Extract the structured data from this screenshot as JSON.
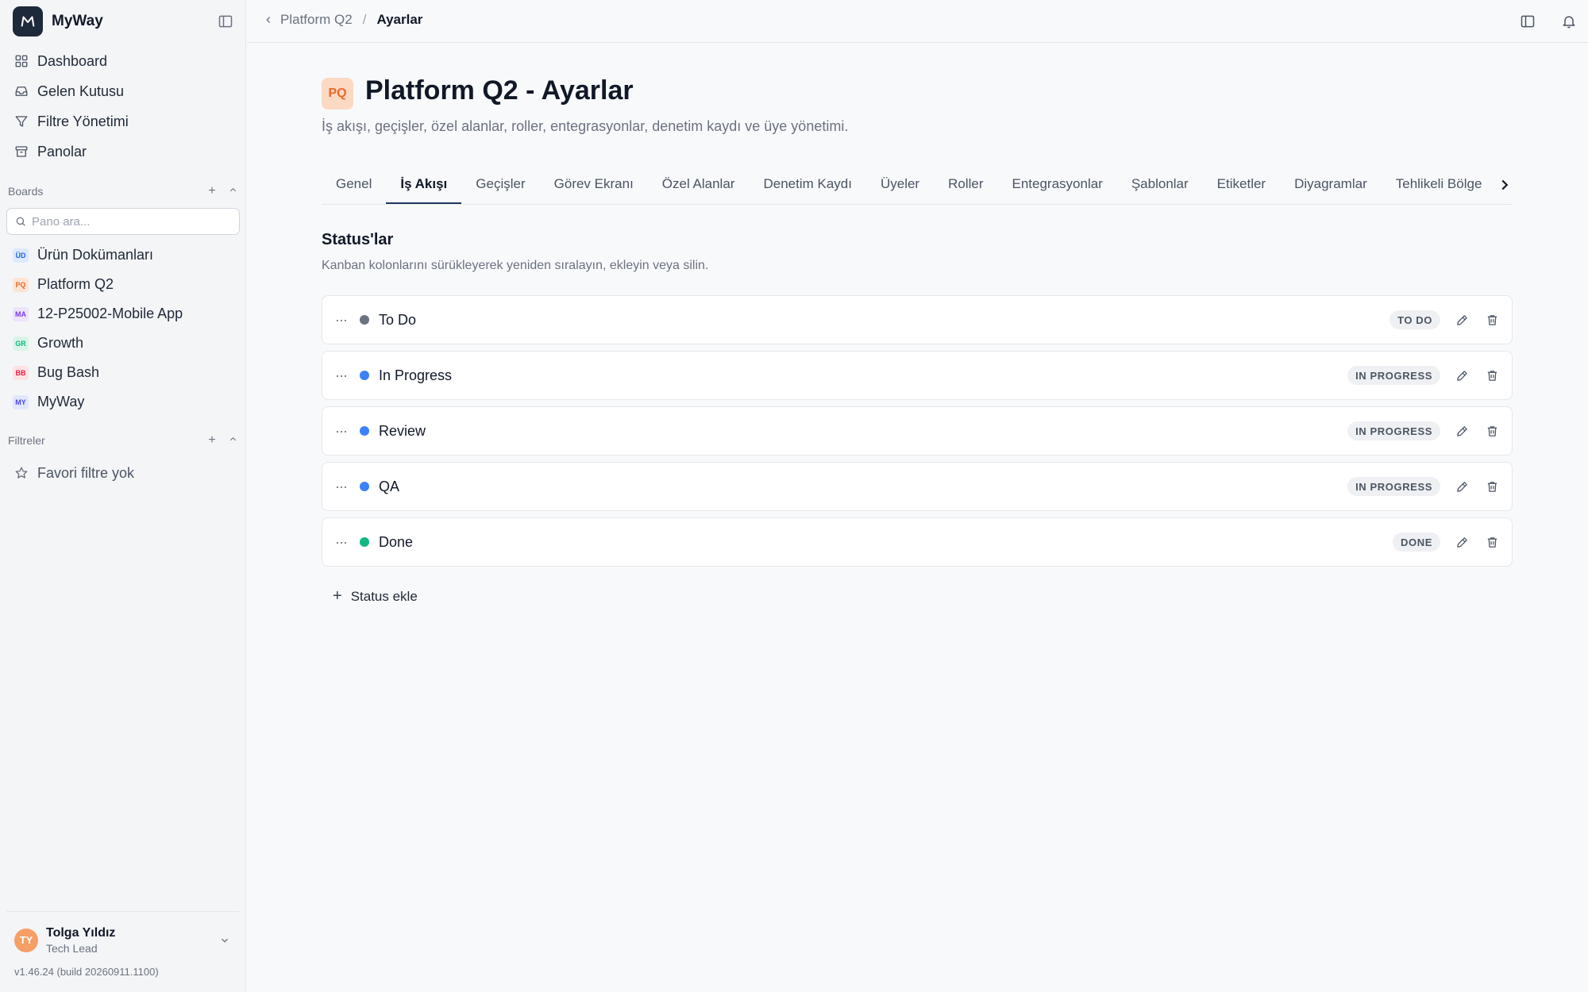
{
  "app": {
    "name": "MyWay",
    "version": "v1.46.24 (build 20260911.1100)"
  },
  "nav": [
    {
      "label": "Dashboard",
      "icon": "dashboard-icon"
    },
    {
      "label": "Gelen Kutusu",
      "icon": "inbox-icon"
    },
    {
      "label": "Filtre Yönetimi",
      "icon": "filter-icon"
    },
    {
      "label": "Panolar",
      "icon": "archive-icon"
    }
  ],
  "boards": {
    "heading": "Boards",
    "search_placeholder": "Pano ara...",
    "items": [
      {
        "badge": "ÜD",
        "label": "Ürün Dokümanları",
        "bg": "#dbeafe",
        "fg": "#2563eb"
      },
      {
        "badge": "PQ",
        "label": "Platform Q2",
        "bg": "#ffe4d4",
        "fg": "#ea6a2b"
      },
      {
        "badge": "MA",
        "label": "12-P25002-Mobile App",
        "bg": "#ede3fb",
        "fg": "#7c3aed"
      },
      {
        "badge": "GR",
        "label": "Growth",
        "bg": "#d9f5e8",
        "fg": "#10b981"
      },
      {
        "badge": "BB",
        "label": "Bug Bash",
        "bg": "#fde2e4",
        "fg": "#e11d48"
      },
      {
        "badge": "MY",
        "label": "MyWay",
        "bg": "#e0e7ff",
        "fg": "#4f46e5"
      }
    ]
  },
  "filters": {
    "heading": "Filtreler",
    "empty": "Favori filtre yok"
  },
  "user": {
    "initials": "TY",
    "name": "Tolga Yıldız",
    "role": "Tech Lead"
  },
  "breadcrumb": {
    "parent": "Platform Q2",
    "separator": "/",
    "current": "Ayarlar"
  },
  "page": {
    "badge": "PQ",
    "title": "Platform Q2 - Ayarlar",
    "subtitle": "İş akışı, geçişler, özel alanlar, roller, entegrasyonlar, denetim kaydı ve üye yönetimi."
  },
  "tabs": [
    {
      "label": "Genel",
      "active": false
    },
    {
      "label": "İş Akışı",
      "active": true
    },
    {
      "label": "Geçişler",
      "active": false
    },
    {
      "label": "Görev Ekranı",
      "active": false
    },
    {
      "label": "Özel Alanlar",
      "active": false
    },
    {
      "label": "Denetim Kaydı",
      "active": false
    },
    {
      "label": "Üyeler",
      "active": false
    },
    {
      "label": "Roller",
      "active": false
    },
    {
      "label": "Entegrasyonlar",
      "active": false
    },
    {
      "label": "Şablonlar",
      "active": false
    },
    {
      "label": "Etiketler",
      "active": false
    },
    {
      "label": "Diyagramlar",
      "active": false
    },
    {
      "label": "Tehlikeli Bölge",
      "active": false
    }
  ],
  "statuses": {
    "title": "Status'lar",
    "description": "Kanban kolonlarını sürükleyerek yeniden sıralayın, ekleyin veya silin.",
    "add_label": "Status ekle",
    "items": [
      {
        "name": "To Do",
        "category": "TO DO",
        "color": "#6b7280"
      },
      {
        "name": "In Progress",
        "category": "IN PROGRESS",
        "color": "#3b82f6"
      },
      {
        "name": "Review",
        "category": "IN PROGRESS",
        "color": "#3b82f6"
      },
      {
        "name": "QA",
        "category": "IN PROGRESS",
        "color": "#3b82f6"
      },
      {
        "name": "Done",
        "category": "DONE",
        "color": "#10b981"
      }
    ]
  }
}
